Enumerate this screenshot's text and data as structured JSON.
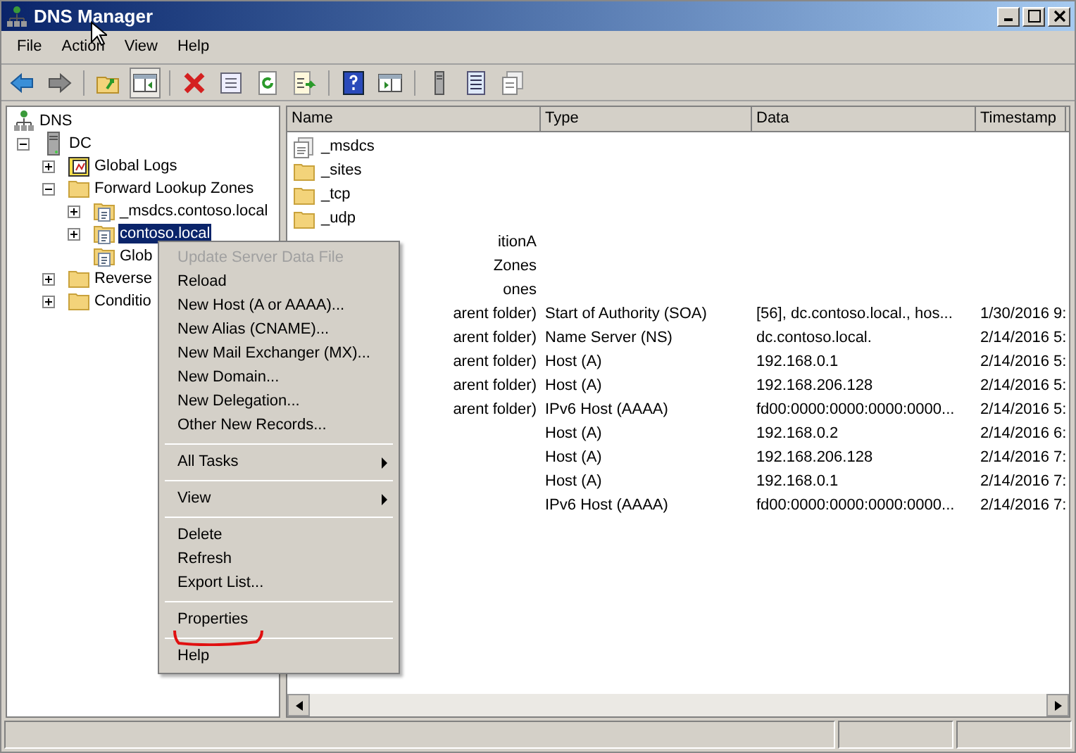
{
  "window": {
    "title": "DNS Manager"
  },
  "menu_bar": [
    "File",
    "Action",
    "View",
    "Help"
  ],
  "toolbar": [
    {
      "kind": "back",
      "pressed": false
    },
    {
      "kind": "forward",
      "pressed": false
    },
    {
      "kind": "sep"
    },
    {
      "kind": "up",
      "pressed": false
    },
    {
      "kind": "tree",
      "pressed": true
    },
    {
      "kind": "sep"
    },
    {
      "kind": "delete",
      "pressed": false
    },
    {
      "kind": "props",
      "pressed": false
    },
    {
      "kind": "refresh",
      "pressed": false
    },
    {
      "kind": "export",
      "pressed": false
    },
    {
      "kind": "sep"
    },
    {
      "kind": "help",
      "pressed": false
    },
    {
      "kind": "action",
      "pressed": false
    },
    {
      "kind": "sep"
    },
    {
      "kind": "server",
      "pressed": false
    },
    {
      "kind": "list",
      "pressed": false
    },
    {
      "kind": "copy",
      "pressed": false
    }
  ],
  "tree": [
    {
      "label": "DNS",
      "kind": "root",
      "expandable": false,
      "expanded": true,
      "selected": false,
      "children": [
        {
          "label": "DC",
          "kind": "server",
          "expandable": true,
          "expanded": true,
          "selected": false,
          "children": [
            {
              "label": "Global Logs",
              "kind": "logs",
              "expandable": true,
              "expanded": false,
              "selected": false
            },
            {
              "label": "Forward Lookup Zones",
              "kind": "folder",
              "expandable": true,
              "expanded": true,
              "selected": false,
              "children": [
                {
                  "label": "_msdcs.contoso.local",
                  "kind": "zone",
                  "expandable": true,
                  "expanded": false,
                  "selected": false
                },
                {
                  "label": "contoso.local",
                  "kind": "zone",
                  "expandable": true,
                  "expanded": false,
                  "selected": true
                },
                {
                  "label": "Glob",
                  "kind": "zone",
                  "expandable": false,
                  "expanded": false,
                  "selected": false
                }
              ]
            },
            {
              "label": "Reverse",
              "kind": "folder",
              "expandable": true,
              "expanded": false,
              "selected": false
            },
            {
              "label": "Conditio",
              "kind": "folder",
              "expandable": true,
              "expanded": false,
              "selected": false
            }
          ]
        }
      ]
    }
  ],
  "list": {
    "columns": [
      "Name",
      "Type",
      "Data",
      "Timestamp"
    ],
    "rows": [
      {
        "kind": "zone",
        "name": "_msdcs"
      },
      {
        "kind": "folder",
        "name": "_sites"
      },
      {
        "kind": "folder",
        "name": "_tcp"
      },
      {
        "kind": "folder",
        "name": "_udp"
      },
      {
        "kind": "covered",
        "name": "itionA"
      },
      {
        "kind": "covered",
        "name": "Zones"
      },
      {
        "kind": "covered",
        "name": "ones"
      },
      {
        "kind": "covered",
        "name": "arent folder)",
        "type": "Start of Authority (SOA)",
        "data": "[56], dc.contoso.local., hos...",
        "timestamp": "1/30/2016 9:"
      },
      {
        "kind": "covered",
        "name": "arent folder)",
        "type": "Name Server (NS)",
        "data": "dc.contoso.local.",
        "timestamp": "2/14/2016 5:"
      },
      {
        "kind": "covered",
        "name": "arent folder)",
        "type": "Host (A)",
        "data": "192.168.0.1",
        "timestamp": "2/14/2016 5:"
      },
      {
        "kind": "covered",
        "name": "arent folder)",
        "type": "Host (A)",
        "data": "192.168.206.128",
        "timestamp": "2/14/2016 5:"
      },
      {
        "kind": "covered",
        "name": "arent folder)",
        "type": "IPv6 Host (AAAA)",
        "data": "fd00:0000:0000:0000:0000...",
        "timestamp": "2/14/2016 5:"
      },
      {
        "kind": "covered",
        "type": "Host (A)",
        "data": "192.168.0.2",
        "timestamp": "2/14/2016 6:"
      },
      {
        "kind": "covered",
        "type": "Host (A)",
        "data": "192.168.206.128",
        "timestamp": "2/14/2016 7:"
      },
      {
        "kind": "covered",
        "type": "Host (A)",
        "data": "192.168.0.1",
        "timestamp": "2/14/2016 7:"
      },
      {
        "kind": "covered",
        "type": "IPv6 Host (AAAA)",
        "data": "fd00:0000:0000:0000:0000...",
        "timestamp": "2/14/2016 7:"
      }
    ]
  },
  "context_menu": [
    {
      "kind": "item",
      "label": "Update Server Data File",
      "disabled": true,
      "highlighted": false
    },
    {
      "kind": "item",
      "label": "Reload",
      "disabled": false,
      "highlighted": false
    },
    {
      "kind": "item",
      "label": "New Host (A or AAAA)...",
      "disabled": false,
      "highlighted": false
    },
    {
      "kind": "item",
      "label": "New Alias (CNAME)...",
      "disabled": false,
      "highlighted": false
    },
    {
      "kind": "item",
      "label": "New Mail Exchanger (MX)...",
      "disabled": false,
      "highlighted": false
    },
    {
      "kind": "item",
      "label": "New Domain...",
      "disabled": false,
      "highlighted": false
    },
    {
      "kind": "item",
      "label": "New Delegation...",
      "disabled": false,
      "highlighted": false
    },
    {
      "kind": "item",
      "label": "Other New Records...",
      "disabled": false,
      "highlighted": false
    },
    {
      "kind": "separator"
    },
    {
      "kind": "submenu",
      "label": "All Tasks",
      "disabled": false,
      "highlighted": false
    },
    {
      "kind": "separator"
    },
    {
      "kind": "submenu",
      "label": "View",
      "disabled": false,
      "highlighted": false
    },
    {
      "kind": "separator"
    },
    {
      "kind": "item",
      "label": "Delete",
      "disabled": false,
      "highlighted": false
    },
    {
      "kind": "item",
      "label": "Refresh",
      "disabled": false,
      "highlighted": false
    },
    {
      "kind": "item",
      "label": "Export List...",
      "disabled": false,
      "highlighted": false
    },
    {
      "kind": "separator"
    },
    {
      "kind": "item",
      "label": "Properties",
      "disabled": false,
      "highlighted": true
    },
    {
      "kind": "separator"
    },
    {
      "kind": "item",
      "label": "Help",
      "disabled": false,
      "highlighted": false
    }
  ]
}
